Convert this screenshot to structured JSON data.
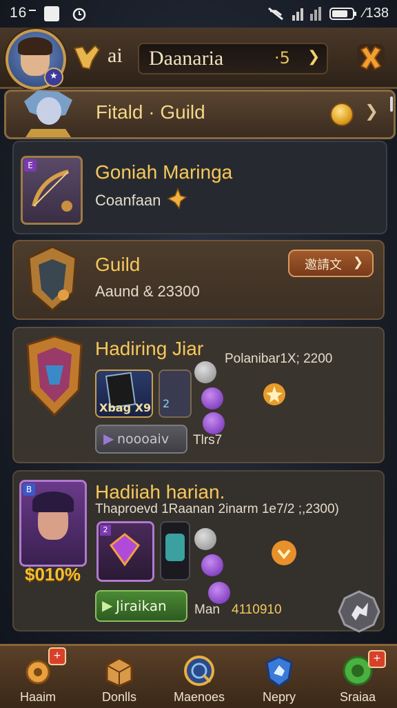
{
  "status_bar": {
    "time": "16",
    "right_text": "⁄138"
  },
  "header": {
    "prefix": "ai",
    "player_name": "Daanaria",
    "value": "·5",
    "chevron": "❯"
  },
  "guild_banner": {
    "title": "Fitald · Guild",
    "chevron": "❯"
  },
  "card_profile": {
    "title": "Goniah Maringa",
    "subtitle": "Coanfaan",
    "badge": "E"
  },
  "card_guild": {
    "title": "Guild",
    "subtitle": "Aaund & 23300",
    "button_label": "邀請文",
    "button_chevron": "❯"
  },
  "card_daily1": {
    "title": "Hadiring Jiar",
    "info": "Polanibar1X; 2200",
    "item1_label": "Xbag X9",
    "item2_label": "2",
    "button_label": "noooaiv",
    "footer": "Tlrs7"
  },
  "card_daily2": {
    "title": "Hadiiah harian.",
    "info": "Thaproevd 1Raanan 2inarm 1e7/2 ;,2300)",
    "badge": "B",
    "percent": "$010%",
    "item_badge": "2",
    "button_label": "Jiraikan",
    "footer_prefix": "Man",
    "footer_value": "4110910"
  },
  "bottom_nav": [
    {
      "label": "Haaim"
    },
    {
      "label": "Donlls"
    },
    {
      "label": "Maenoes"
    },
    {
      "label": "Nepry"
    },
    {
      "label": "Sraiaa"
    }
  ],
  "alert_mark": "+",
  "colors": {
    "gold": "#f2c860",
    "panel": "#3a342e",
    "accent_purple": "#9a5ad0",
    "green_button": "#3e7a2c"
  }
}
